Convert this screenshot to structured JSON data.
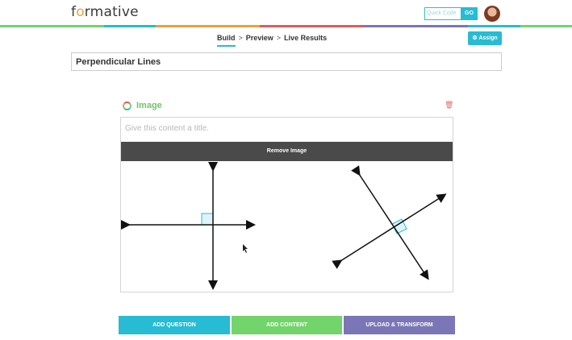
{
  "header": {
    "logo_text_pre": "f",
    "logo_text_o": "o",
    "logo_text_post": "rmative",
    "quick_code_placeholder": "Quick Code",
    "go_label": "GO"
  },
  "rainbow_colors": [
    "#72d46b",
    "#72d46b",
    "#27bcd3",
    "#e8a33c",
    "#e8a33c",
    "#e25a5a",
    "#e25a5a",
    "#7b76b5",
    "#7b76b5",
    "#27bcd3",
    "#72d46b"
  ],
  "subnav": {
    "steps": [
      "Build",
      "Preview",
      "Live Results"
    ],
    "separator": ">",
    "assign_label": "Assign",
    "title_value": "Perpendicular Lines"
  },
  "card": {
    "label": "Image",
    "title_placeholder": "Give this content a title.",
    "remove_label": "Remove Image"
  },
  "buttons": {
    "add_question": "ADD QUESTION",
    "add_content": "ADD CONTENT",
    "upload_transform": "UPLOAD & TRANSFORM"
  },
  "colors": {
    "accent": "#27bcd3",
    "green": "#72d46b",
    "purple": "#7b76b5"
  }
}
